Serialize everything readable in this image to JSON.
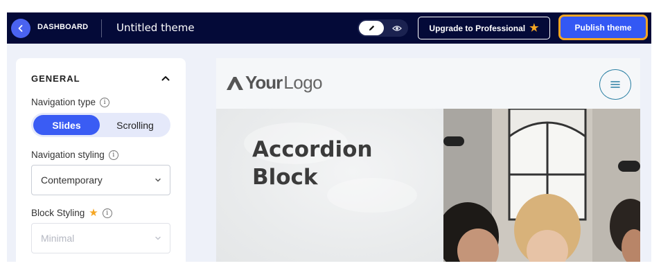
{
  "topbar": {
    "back_icon": "chevron-left-icon",
    "dashboard_label": "DASHBOARD",
    "theme_title": "Untitled theme",
    "mode_toggle": {
      "edit_icon": "pencil-icon",
      "preview_icon": "eye-icon",
      "selected": "edit"
    },
    "upgrade_label": "Upgrade to Professional",
    "upgrade_icon": "star-icon",
    "publish_label": "Publish theme",
    "colors": {
      "bar": "#040a38",
      "accent": "#3358f4",
      "highlight": "#f5a623"
    }
  },
  "sidebar": {
    "section_title": "GENERAL",
    "section_state": "expanded",
    "navigation_type": {
      "label": "Navigation type",
      "options": [
        "Slides",
        "Scrolling"
      ],
      "selected": "Slides"
    },
    "navigation_styling": {
      "label": "Navigation styling",
      "value": "Contemporary"
    },
    "block_styling": {
      "label": "Block Styling",
      "premium_icon": "star-icon",
      "value": "Minimal",
      "disabled": true
    }
  },
  "preview": {
    "logo_bold": "Your",
    "logo_light": "Logo",
    "menu_icon": "hamburger-menu-icon",
    "block_heading": "Accordion Block",
    "image": "photo of people in a cafe"
  }
}
